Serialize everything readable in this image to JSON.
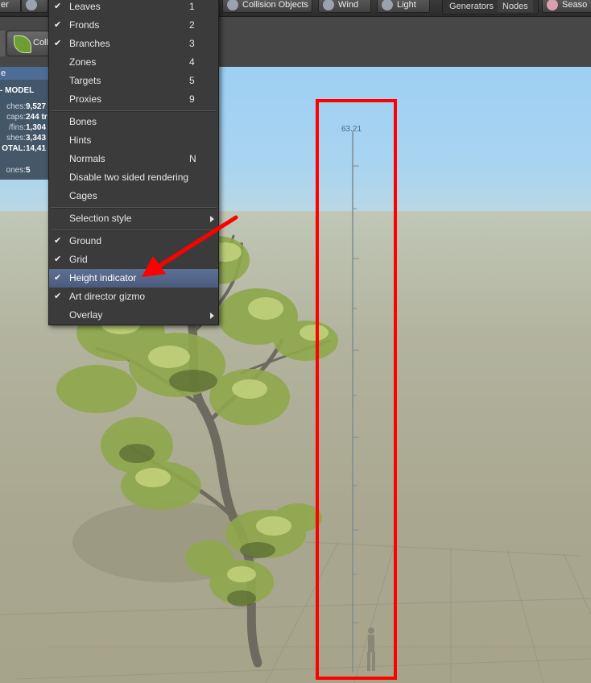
{
  "toolbar": {
    "buttons": [
      {
        "label": "er"
      },
      {
        "label": ""
      },
      {
        "label": "Collision Objects"
      },
      {
        "label": "Wind"
      },
      {
        "label": "Light"
      }
    ],
    "segmented": [
      "Generators",
      "Nodes"
    ],
    "right_button": "Seaso",
    "leaf_button_label": "Colli"
  },
  "stats": {
    "header": "e",
    "title": "- MODEL",
    "rows": [
      {
        "key": "ches:",
        "value": "9,527"
      },
      {
        "key": "caps:",
        "value": "244 tr"
      },
      {
        "key": "/fins:",
        "value": "1,304"
      },
      {
        "key": "shes:",
        "value": "3,343"
      },
      {
        "key": "OTAL:",
        "value": "14,41"
      },
      {
        "key": "ones:",
        "value": "5"
      }
    ]
  },
  "menu": {
    "items": [
      {
        "label": "Leaves",
        "checked": true,
        "shortcut": "1"
      },
      {
        "label": "Fronds",
        "checked": true,
        "shortcut": "2"
      },
      {
        "label": "Branches",
        "checked": true,
        "shortcut": "3"
      },
      {
        "label": "Zones",
        "checked": false,
        "shortcut": "4"
      },
      {
        "label": "Targets",
        "checked": false,
        "shortcut": "5"
      },
      {
        "label": "Proxies",
        "checked": false,
        "shortcut": "9"
      },
      {
        "label": "Bones",
        "checked": false,
        "shortcut": ""
      },
      {
        "label": "Hints",
        "checked": false,
        "shortcut": ""
      },
      {
        "label": "Normals",
        "checked": false,
        "shortcut": "N"
      },
      {
        "label": "Disable two sided rendering",
        "checked": false,
        "shortcut": ""
      },
      {
        "label": "Cages",
        "checked": false,
        "shortcut": ""
      },
      {
        "label": "Selection style",
        "checked": false,
        "shortcut": "",
        "submenu": true
      },
      {
        "label": "Ground",
        "checked": true,
        "shortcut": ""
      },
      {
        "label": "Grid",
        "checked": true,
        "shortcut": ""
      },
      {
        "label": "Height indicator",
        "checked": true,
        "shortcut": "",
        "highlighted": true
      },
      {
        "label": "Art director gizmo",
        "checked": true,
        "shortcut": ""
      },
      {
        "label": "Overlay",
        "checked": false,
        "shortcut": "",
        "submenu": true
      }
    ],
    "check_glyph": "✔"
  },
  "viewport": {
    "height_value": "63.21"
  },
  "colors": {
    "annotation_red": "#ff0000",
    "menu_highlight": "#5d6f92",
    "foliage": "#8da84a"
  }
}
